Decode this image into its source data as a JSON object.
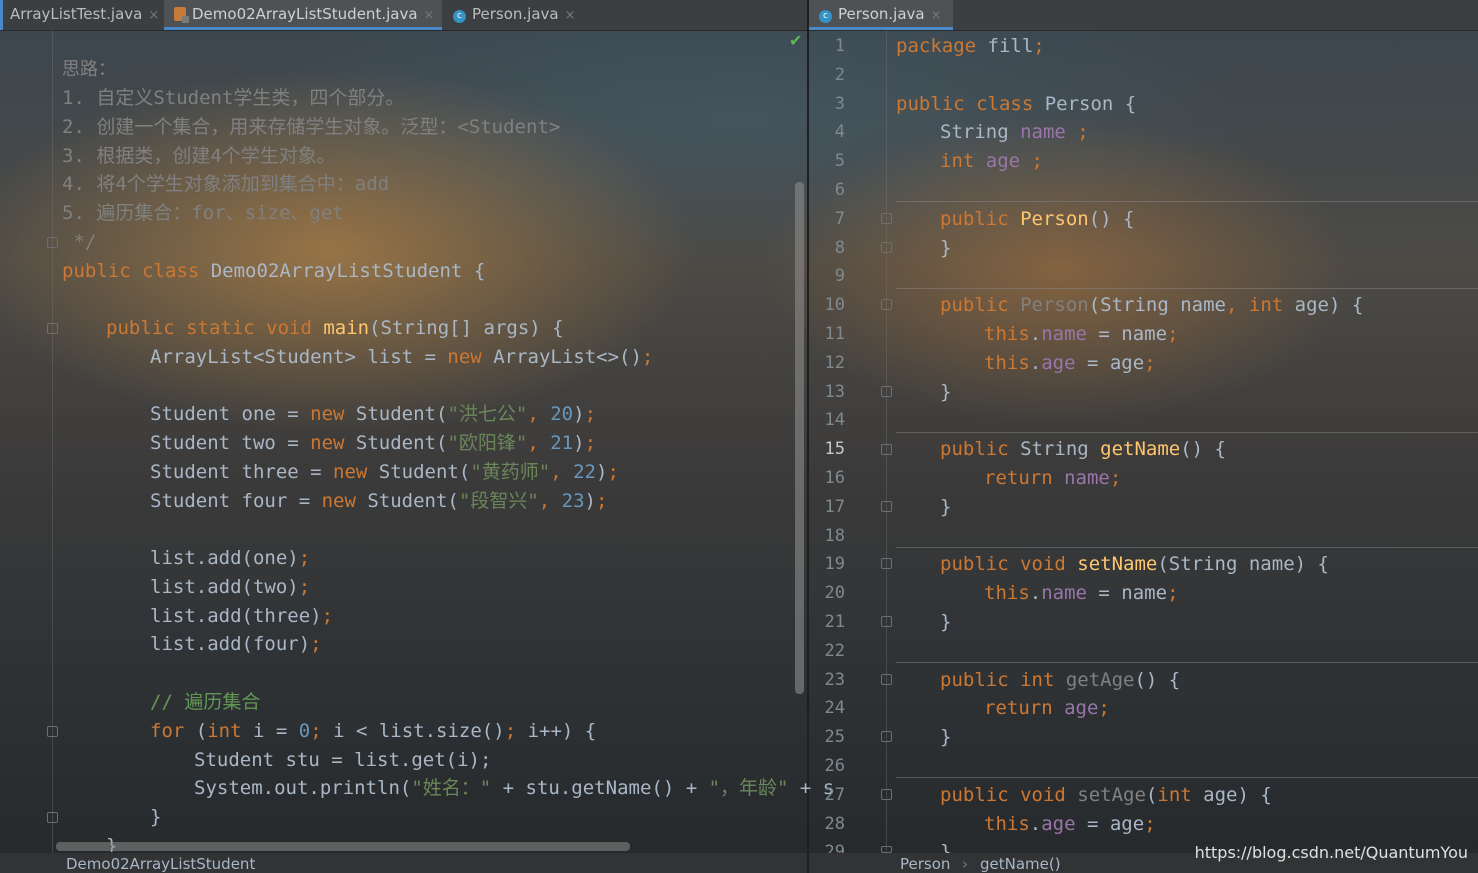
{
  "tabs_left": [
    {
      "label": "ArrayListTest.java",
      "active": false
    },
    {
      "label": "Demo02ArrayListStudent.java",
      "active": true
    },
    {
      "label": "Person.java",
      "active": false
    }
  ],
  "tabs_right": [
    {
      "label": "Person.java",
      "active": true
    }
  ],
  "tab_close_glyph": "×",
  "left_editor": {
    "comment": [
      "思路：",
      "1. 自定义Student学生类，四个部分。",
      "2. 创建一个集合，用来存储学生对象。泛型：<Student>",
      "3. 根据类，创建4个学生对象。",
      "4. 将4个学生对象添加到集合中：add",
      "5. 遍历集合：for、size、get",
      " */"
    ],
    "class_decl": {
      "kw": "public class ",
      "name": "Demo02ArrayListStudent {"
    },
    "main_decl": {
      "kw": "public static void ",
      "method": "main",
      "rest": "(String[] args) {"
    },
    "list_decl": {
      "a": "ArrayList<Student> list = ",
      "kw": "new ",
      "b": "ArrayList<>()",
      "semi": ";"
    },
    "students": [
      {
        "var": "Student one = ",
        "name": "\"洪七公\"",
        "age": "20"
      },
      {
        "var": "Student two = ",
        "name": "\"欧阳锋\"",
        "age": "21"
      },
      {
        "var": "Student three = ",
        "name": "\"黄药师\"",
        "age": "22"
      },
      {
        "var": "Student four = ",
        "name": "\"段智兴\"",
        "age": "23"
      }
    ],
    "adds": [
      "list.add(one)",
      "list.add(two)",
      "list.add(three)",
      "list.add(four)"
    ],
    "loop_comment": "// 遍历集合",
    "for_line": {
      "kw1": "for ",
      "p1": "(",
      "kw2": "int ",
      "p2": "i = ",
      "zero": "0",
      "p3": "; i < list.size()",
      "p4": "; i++) {"
    },
    "get_line": "Student stu = list.get(i);",
    "print_line": {
      "a": "System.out.println(",
      "s1": "\"姓名：\"",
      "b": " + stu.getName() + ",
      "s2": "\"，年龄\"",
      "c": " + s"
    },
    "close_brace": "}",
    "close_brace2": "}",
    "breadcrumb": "Demo02ArrayListStudent"
  },
  "right_editor": {
    "line_numbers": [
      "1",
      "2",
      "3",
      "4",
      "5",
      "6",
      "7",
      "8",
      "9",
      "10",
      "11",
      "12",
      "13",
      "14",
      "15",
      "16",
      "17",
      "18",
      "19",
      "20",
      "21",
      "22",
      "23",
      "24",
      "25",
      "26",
      "27",
      "28",
      "29"
    ],
    "current_line": "15",
    "breadcrumb": [
      "Person",
      "getName()"
    ],
    "breadcrumb_sep": "›",
    "code": {
      "pkg": {
        "kw": "package ",
        "rest": "fill",
        "semi": ";"
      },
      "cls": {
        "kw": "public class ",
        "rest": "Person {"
      },
      "f_name": {
        "type": "String ",
        "field": "name ",
        "semi": ";"
      },
      "f_age": {
        "kw": "int ",
        "field": "age ",
        "semi": ";"
      },
      "ctor1": {
        "kw": "public ",
        "m": "Person",
        "rest": "() {"
      },
      "ctor2": {
        "kw": "public ",
        "m": "Person",
        "p": "(String name",
        "comma": ", ",
        "kw2": "int ",
        "rest": "age) {"
      },
      "this_name": {
        "kw": "this",
        "dot": ".",
        "f": "name",
        "rest": " = name",
        "semi": ";"
      },
      "this_age": {
        "kw": "this",
        "dot": ".",
        "f": "age",
        "rest": " = age",
        "semi": ";"
      },
      "getName": {
        "kw": "public ",
        "type": "String ",
        "m": "getName",
        "rest": "() {"
      },
      "ret_name": {
        "kw": "return ",
        "f": "name",
        "semi": ";"
      },
      "setName": {
        "kw": "public void ",
        "m": "setName",
        "rest": "(String name) {"
      },
      "getAge": {
        "kw": "public int ",
        "m": "getAge",
        "rest": "() {"
      },
      "ret_age": {
        "kw": "return ",
        "f": "age",
        "semi": ";"
      },
      "setAge": {
        "kw": "public void ",
        "m": "setAge",
        "p": "(",
        "kw2": "int ",
        "rest": "age) {"
      },
      "brace": "}"
    }
  },
  "watermark": "https://blog.csdn.net/QuantumYou",
  "colors": {
    "keyword": "#cc7832",
    "method": "#ffc66d",
    "field": "#9876aa",
    "string": "#6a8759",
    "number": "#6897bb",
    "comment": "#808080",
    "line_comment": "#629755",
    "text": "#a9b7c6",
    "tab_underline": "#4a88c7"
  },
  "icons": [
    "java-class-icon",
    "java-file-icon",
    "close-icon",
    "fold-icon",
    "check-icon"
  ]
}
